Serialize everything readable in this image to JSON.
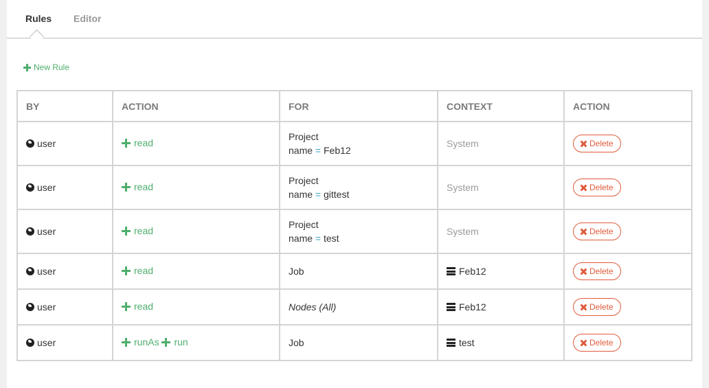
{
  "tabs": {
    "rules": "Rules",
    "editor": "Editor"
  },
  "new_rule_label": "New Rule",
  "table": {
    "headers": [
      "BY",
      "ACTION",
      "FOR",
      "CONTEXT",
      "ACTION"
    ],
    "rows": [
      {
        "by": "user",
        "actions": [
          "read"
        ],
        "for_type": "Project",
        "for_key": "name",
        "for_op": "=",
        "for_value": "Feb12",
        "context": "System",
        "context_is_system": true,
        "delete": "Delete"
      },
      {
        "by": "user",
        "actions": [
          "read"
        ],
        "for_type": "Project",
        "for_key": "name",
        "for_op": "=",
        "for_value": "gittest",
        "context": "System",
        "context_is_system": true,
        "delete": "Delete"
      },
      {
        "by": "user",
        "actions": [
          "read"
        ],
        "for_type": "Project",
        "for_key": "name",
        "for_op": "=",
        "for_value": "test",
        "context": "System",
        "context_is_system": true,
        "delete": "Delete"
      },
      {
        "by": "user",
        "actions": [
          "read"
        ],
        "for_type": "Job",
        "context": "Feb12",
        "context_is_system": false,
        "delete": "Delete"
      },
      {
        "by": "user",
        "actions": [
          "read"
        ],
        "for_type": "Nodes (All)",
        "for_italic": true,
        "context": "Feb12",
        "context_is_system": false,
        "delete": "Delete"
      },
      {
        "by": "user",
        "actions": [
          "runAs",
          "run"
        ],
        "for_type": "Job",
        "context": "test",
        "context_is_system": false,
        "delete": "Delete"
      }
    ]
  },
  "icons": {
    "by": "globe-icon",
    "action": "plus-icon",
    "context": "server-icon",
    "delete": "close-icon"
  },
  "colors": {
    "accent_green": "#4fae6c",
    "delete_red": "#e05a3a",
    "equals_blue": "#3aa0c8"
  }
}
